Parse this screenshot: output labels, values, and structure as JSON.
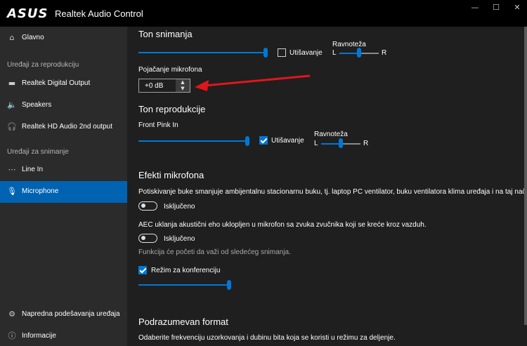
{
  "titlebar": {
    "logo": "ASUS",
    "title": "Realtek Audio Control",
    "minimize": "—",
    "maximize": "☐",
    "close": "✕"
  },
  "sidebar": {
    "main_label": "Glavno",
    "playback_section": "Uređaji za reprodukciju",
    "playback_items": [
      "Realtek Digital Output",
      "Speakers",
      "Realtek HD Audio 2nd output"
    ],
    "recording_section": "Uređaji za snimanje",
    "recording_items": [
      "Line In",
      "Microphone"
    ],
    "advanced": "Napredna podešavanja uređaja",
    "info": "Informacije"
  },
  "main": {
    "recording_volume": {
      "title": "Ton snimanja",
      "level": 1.0,
      "mute_label": "Utišavanje",
      "mute_checked": false,
      "balance_label": "Ravnoteža",
      "balance_left": "L",
      "balance_right": "R",
      "balance": 0.5
    },
    "mic_boost": {
      "label": "Pojačanje mikrofona",
      "value": "+0 dB"
    },
    "playback_volume": {
      "title": "Ton reprodukcije",
      "device": "Front Pink In",
      "level": 1.0,
      "mute_label": "Utišavanje",
      "mute_checked": true,
      "balance_label": "Ravnoteža",
      "balance_left": "L",
      "balance_right": "R",
      "balance": 0.5
    },
    "mic_effects": {
      "title": "Efekti mikrofona",
      "noise_desc": "Potiskivanje buke smanjuje ambijentalnu stacionarnu buku, tj. laptop PC ventilator, buku ventilatora klima uređaja i na taj nač",
      "noise_state": "Isključeno",
      "aec_desc": "AEC uklanja akustični eho ukloplјen u mikrofon sa zvuka zvučnika koji se kreće kroz vazduh.",
      "aec_state": "Isključeno",
      "note": "Funkcija će početi da važi od sledećeg snimanja.",
      "conference_label": "Režim za konferenciju",
      "conference_checked": true,
      "conference_level": 1.0
    },
    "default_format": {
      "title": "Podrazumevan format",
      "desc": "Odaberite frekvenciju uzorkovanja i dubinu bita koja se koristi u režimu za deljenje."
    }
  },
  "colors": {
    "accent": "#0078d7",
    "active_nav": "#0063b1",
    "arrow": "#e0161b"
  }
}
